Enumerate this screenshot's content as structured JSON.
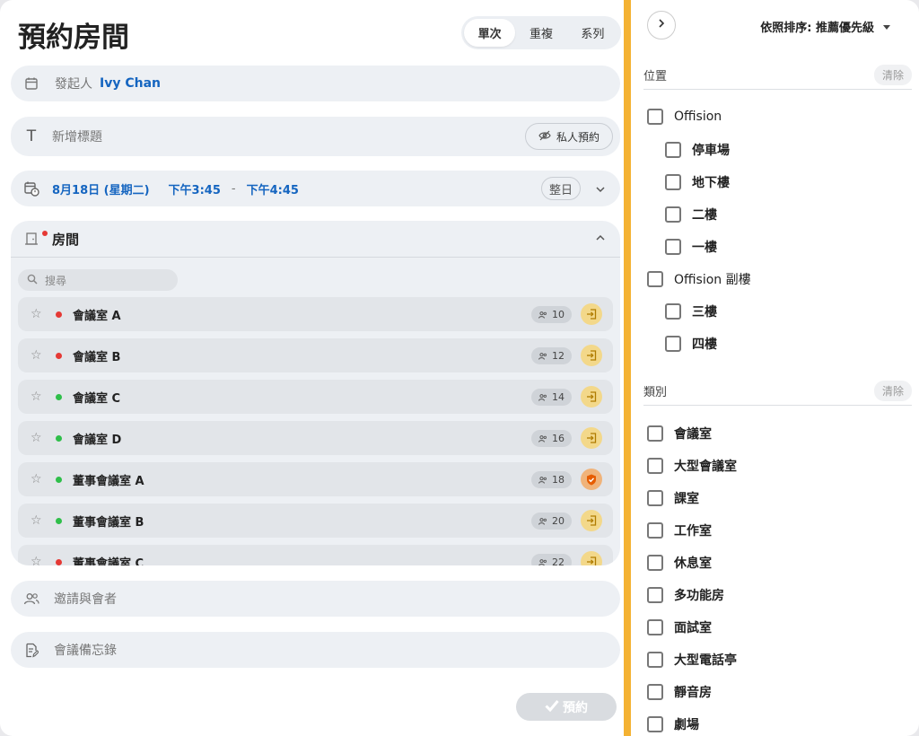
{
  "header": {
    "title": "預約房間",
    "segments": [
      "單次",
      "重複",
      "系列"
    ],
    "active_segment": "單次"
  },
  "organizer": {
    "label": "發起人",
    "name": "Ivy Chan"
  },
  "title_field": {
    "placeholder": "新增標題",
    "private_label": "私人預約"
  },
  "datetime": {
    "date": "8月18日 (星期二)",
    "start": "下午3:45",
    "separator": "-",
    "end": "下午4:45",
    "all_day_label": "整日"
  },
  "rooms": {
    "heading": "房間",
    "search_placeholder": "搜尋",
    "items": [
      {
        "name": "會議室 A",
        "status_color": "#e53935",
        "capacity": "10",
        "action": "enter"
      },
      {
        "name": "會議室 B",
        "status_color": "#e53935",
        "capacity": "12",
        "action": "enter"
      },
      {
        "name": "會議室 C",
        "status_color": "#2fbf4a",
        "capacity": "14",
        "action": "enter"
      },
      {
        "name": "會議室 D",
        "status_color": "#2fbf4a",
        "capacity": "16",
        "action": "enter"
      },
      {
        "name": "董事會議室 A",
        "status_color": "#2fbf4a",
        "capacity": "18",
        "action": "shield"
      },
      {
        "name": "董事會議室 B",
        "status_color": "#2fbf4a",
        "capacity": "20",
        "action": "enter"
      },
      {
        "name": "董事會議室 C",
        "status_color": "#e53935",
        "capacity": "22",
        "action": "enter"
      }
    ]
  },
  "invite": {
    "placeholder": "邀請與會者"
  },
  "notes": {
    "placeholder": "會議備忘錄"
  },
  "book_button": {
    "label": "預約"
  },
  "filter": {
    "sort_label": "依照排序: 推薦優先級",
    "location": {
      "title": "位置",
      "clear": "清除",
      "options": [
        {
          "label": "Offision",
          "level": 0
        },
        {
          "label": "停車場",
          "level": 1
        },
        {
          "label": "地下樓",
          "level": 1
        },
        {
          "label": "二樓",
          "level": 1
        },
        {
          "label": "一樓",
          "level": 1
        },
        {
          "label": "Offision 副樓",
          "level": 0
        },
        {
          "label": "三樓",
          "level": 1
        },
        {
          "label": "四樓",
          "level": 1
        }
      ]
    },
    "category": {
      "title": "類別",
      "clear": "清除",
      "options": [
        "會議室",
        "大型會議室",
        "課室",
        "工作室",
        "休息室",
        "多功能房",
        "面試室",
        "大型電話亭",
        "靜音房",
        "劇場"
      ]
    }
  }
}
